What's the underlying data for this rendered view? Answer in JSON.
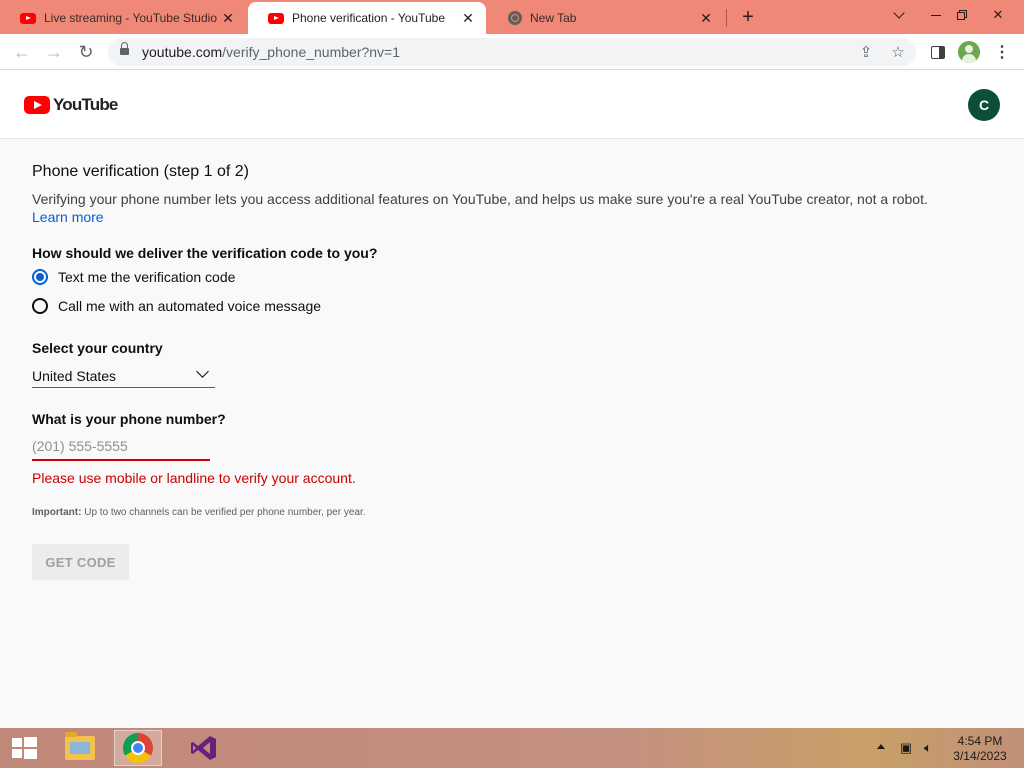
{
  "browser": {
    "tabs": [
      {
        "title": "Live streaming - YouTube Studio",
        "favicon": "youtube-icon",
        "active": false
      },
      {
        "title": "Phone verification - YouTube",
        "favicon": "youtube-icon",
        "active": true
      },
      {
        "title": "New Tab",
        "favicon": "chrome-icon",
        "active": false
      }
    ],
    "url_host": "youtube.com",
    "url_path": "/verify_phone_number?nv=1",
    "tab_bar_color": "#f08878"
  },
  "masthead": {
    "logo_text": "YouTube",
    "avatar_letter": "C",
    "avatar_color": "#0b4f3a"
  },
  "verification": {
    "title": "Phone verification (step 1 of 2)",
    "description": "Verifying your phone number lets you access additional features on YouTube, and helps us make sure you're a real YouTube creator, not a robot.",
    "learn_more": "Learn more",
    "delivery_question": "How should we deliver the verification code to you?",
    "options": [
      {
        "label": "Text me the verification code",
        "selected": true
      },
      {
        "label": "Call me with an automated voice message",
        "selected": false
      }
    ],
    "country_label": "Select your country",
    "country_value": "United States",
    "phone_label": "What is your phone number?",
    "phone_placeholder": "(201) 555-5555",
    "phone_value": "",
    "error_text": "Please use mobile or landline to verify your account.",
    "important_label": "Important:",
    "important_text": " Up to two channels can be verified per phone number, per year.",
    "get_code_label": "GET CODE",
    "accent_color": "#065fd4",
    "error_color": "#cc0000"
  },
  "taskbar": {
    "time": "4:54 PM",
    "date": "3/14/2023"
  }
}
